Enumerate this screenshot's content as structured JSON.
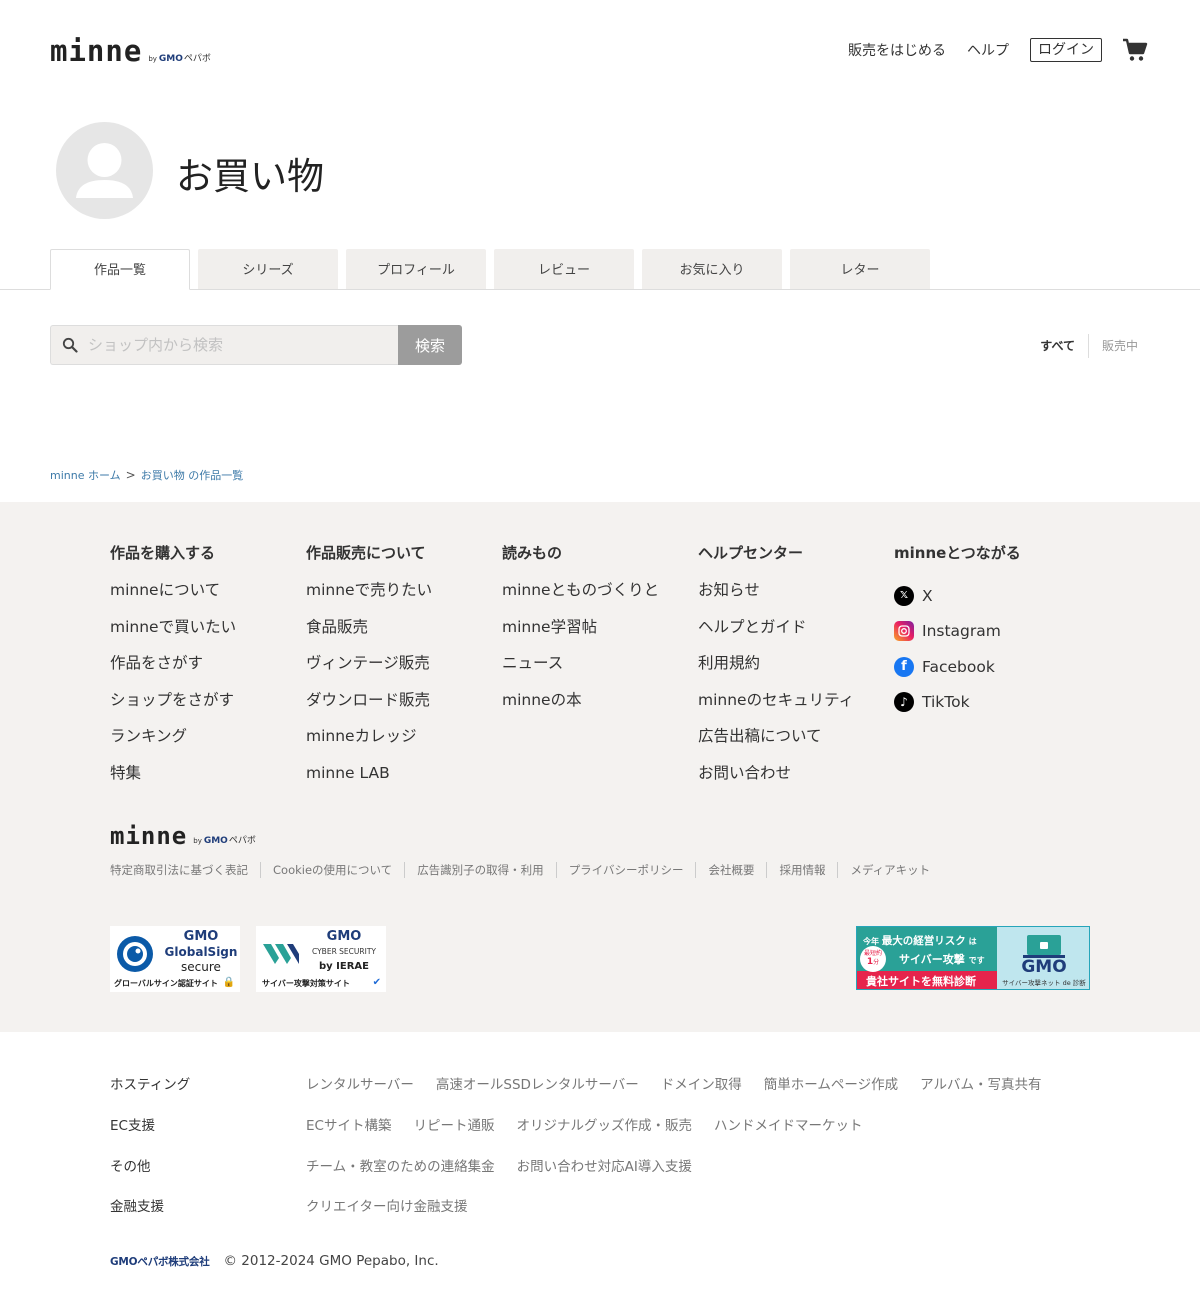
{
  "header": {
    "logo": "minne",
    "logo_by": "by",
    "logo_gmo": "GMO",
    "logo_pepabo": "ペパボ",
    "nav_sell": "販売をはじめる",
    "nav_help": "ヘルプ",
    "nav_login": "ログイン",
    "cart_icon": "cart-icon"
  },
  "profile": {
    "title": "お買い物",
    "avatar_icon": "person-icon"
  },
  "tabs": [
    {
      "label": "作品一覧",
      "active": true
    },
    {
      "label": "シリーズ"
    },
    {
      "label": "プロフィール"
    },
    {
      "label": "レビュー"
    },
    {
      "label": "お気に入り"
    },
    {
      "label": "レター"
    }
  ],
  "search": {
    "placeholder": "ショップ内から検索",
    "button": "検索",
    "icon": "search-icon"
  },
  "filter": {
    "all": "すべて",
    "on_sale": "販売中"
  },
  "breadcrumb": {
    "home": "minne ホーム",
    "separator": ">",
    "current": "お買い物 の作品一覧"
  },
  "footer": {
    "columns": [
      {
        "title": "作品を購入する",
        "links": [
          "minneについて",
          "minneで買いたい",
          "作品をさがす",
          "ショップをさがす",
          "ランキング",
          "特集"
        ]
      },
      {
        "title": "作品販売について",
        "links": [
          "minneで売りたい",
          "食品販売",
          "ヴィンテージ販売",
          "ダウンロード販売",
          "minneカレッジ",
          "minne LAB"
        ]
      },
      {
        "title": "読みもの",
        "links": [
          "minneとものづくりと",
          "minne学習帖",
          "ニュース",
          "minneの本"
        ]
      },
      {
        "title": "ヘルプセンター",
        "links": [
          "お知らせ",
          "ヘルプとガイド",
          "利用規約",
          "minneのセキュリティ",
          "広告出稿について",
          "お問い合わせ"
        ]
      }
    ],
    "social": {
      "title": "minneとつながる",
      "items": [
        "X",
        "Instagram",
        "Facebook",
        "TikTok"
      ],
      "icons": [
        "x-icon",
        "instagram-icon",
        "facebook-icon",
        "tiktok-icon"
      ]
    },
    "legal_links": [
      "特定商取引法に基づく表記",
      "Cookieの使用について",
      "広告識別子の取得・利用",
      "プライバシーポリシー",
      "会社概要",
      "採用情報",
      "メディアキット"
    ],
    "badges": {
      "globalsign": {
        "line1": "GMO",
        "line2": "GlobalSign",
        "line3": "secure",
        "caption": "グローバルサイン認証サイト"
      },
      "cyber": {
        "line1": "GMO",
        "line2": "CYBER SECURITY",
        "line3": "by IERAE",
        "caption": "サイバー攻撃対策サイト"
      }
    },
    "banner": {
      "line1a": "今年",
      "line1b": "最大の経営リスク",
      "line1c": "は",
      "line2": "サイバー攻撃",
      "line2b": "です",
      "circle_top": "最短約",
      "circle_num": "1",
      "circle_unit": "分",
      "line3": "貴社サイトを無料診断",
      "gmo": "GMO",
      "caption": "サイバー攻撃ネット de 診断"
    }
  },
  "bottom": {
    "rows": [
      {
        "category": "ホスティング",
        "links": [
          "レンタルサーバー",
          "高速オールSSDレンタルサーバー",
          "ドメイン取得",
          "簡単ホームページ作成",
          "アルバム・写真共有"
        ]
      },
      {
        "category": "EC支援",
        "links": [
          "ECサイト構築",
          "リピート通販",
          "オリジナルグッズ作成・販売",
          "ハンドメイドマーケット"
        ]
      },
      {
        "category": "その他",
        "links": [
          "チーム・教室のための連絡集金",
          "お問い合わせ対応AI導入支援"
        ]
      },
      {
        "category": "金融支援",
        "links": [
          "クリエイター向け金融支援"
        ]
      }
    ],
    "pepabo_logo": "GMOペパボ株式会社",
    "copyright": "© 2012-2024 GMO Pepabo, Inc."
  }
}
